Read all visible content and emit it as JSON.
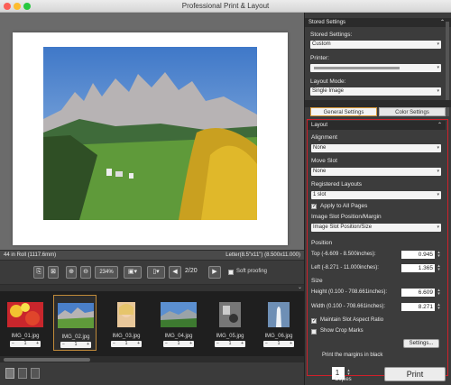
{
  "window": {
    "title": "Professional Print & Layout"
  },
  "preview": {
    "roll_info": "44 in Roll (1117.6mm)",
    "paper_info": "Letter(8.5\"x11\") (8.500x11.000)"
  },
  "toolbar": {
    "zoom": "234%",
    "page": "2/20",
    "soft_proofing": "Soft proofing"
  },
  "thumbnails": [
    {
      "name": "IMG_01.jpg",
      "copies": "1"
    },
    {
      "name": "IMG_02.jpg",
      "copies": "1"
    },
    {
      "name": "IMG_03.jpg",
      "copies": "1"
    },
    {
      "name": "IMG_04.jpg",
      "copies": "1"
    },
    {
      "name": "IMG_05.jpg",
      "copies": "1"
    },
    {
      "name": "IMG_06.jpg",
      "copies": "1"
    }
  ],
  "bottom": {
    "copies_value": "1",
    "copies_label": "Copies",
    "print_label": "Print"
  },
  "panel": {
    "stored_header": "Stored Settings",
    "stored_label": "Stored Settings:",
    "stored_value": "Custom",
    "printer_label": "Printer:",
    "printer_value": "",
    "layout_mode_label": "Layout Mode:",
    "layout_mode_value": "Single Image",
    "tab_general": "General Settings",
    "tab_color": "Color Settings",
    "layout_header": "Layout",
    "alignment_label": "Alignment",
    "alignment_value": "None",
    "move_slot_label": "Move Slot",
    "move_slot_value": "None",
    "registered_label": "Registered Layouts",
    "registered_value": "1 slot",
    "apply_all": "Apply to All Pages",
    "slot_pos_label": "Image Slot Position/Margin",
    "slot_pos_value": "Image Slot Position/Size",
    "position_label": "Position",
    "top_label": "Top (-6.609 - 8.500inches):",
    "top_value": "0.945",
    "left_label": "Left (-8.271 - 11.000inches):",
    "left_value": "1.365",
    "size_label": "Size",
    "height_label": "Height (0.100 - 708.661inches):",
    "height_value": "6.609",
    "width_label": "Width (0.100 - 708.661inches):",
    "width_value": "8.271",
    "maintain_aspect": "Maintain Slot Aspect Ratio",
    "show_crop": "Show Crop Marks",
    "settings_btn": "Settings...",
    "print_margins": "Print the margins in black"
  }
}
